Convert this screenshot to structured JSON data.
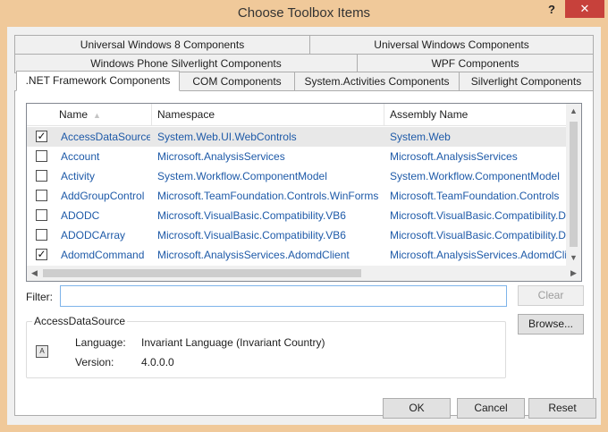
{
  "window": {
    "title": "Choose Toolbox Items",
    "help_label": "?",
    "close_label": "✕"
  },
  "tabs": {
    "row1": [
      "Universal Windows 8 Components",
      "Universal Windows Components"
    ],
    "row2": [
      "Windows Phone Silverlight Components",
      "WPF Components"
    ],
    "row3": [
      ".NET Framework Components",
      "COM Components",
      "System.Activities Components",
      "Silverlight Components"
    ],
    "active": ".NET Framework Components"
  },
  "list": {
    "columns": [
      "Name",
      "Namespace",
      "Assembly Name"
    ],
    "sort_indicator": "▲",
    "rows": [
      {
        "checked": true,
        "name": "AccessDataSource",
        "namespace": "System.Web.UI.WebControls",
        "assembly": "System.Web",
        "selected": true
      },
      {
        "checked": false,
        "name": "Account",
        "namespace": "Microsoft.AnalysisServices",
        "assembly": "Microsoft.AnalysisServices"
      },
      {
        "checked": false,
        "name": "Activity",
        "namespace": "System.Workflow.ComponentModel",
        "assembly": "System.Workflow.ComponentModel"
      },
      {
        "checked": false,
        "name": "AddGroupControl",
        "namespace": "Microsoft.TeamFoundation.Controls.WinForms",
        "assembly": "Microsoft.TeamFoundation.Controls"
      },
      {
        "checked": false,
        "name": "ADODC",
        "namespace": "Microsoft.VisualBasic.Compatibility.VB6",
        "assembly": "Microsoft.VisualBasic.Compatibility.Da"
      },
      {
        "checked": false,
        "name": "ADODCArray",
        "namespace": "Microsoft.VisualBasic.Compatibility.VB6",
        "assembly": "Microsoft.VisualBasic.Compatibility.Da"
      },
      {
        "checked": true,
        "name": "AdomdCommand",
        "namespace": "Microsoft.AnalysisServices.AdomdClient",
        "assembly": "Microsoft.AnalysisServices.AdomdClie"
      }
    ],
    "check_mark": "✓"
  },
  "filter": {
    "label": "Filter:",
    "value": "",
    "clear_label": "Clear"
  },
  "browse_label": "Browse...",
  "details": {
    "title": "AccessDataSource",
    "language_label": "Language:",
    "language_value": "Invariant Language (Invariant Country)",
    "version_label": "Version:",
    "version_value": "4.0.0.0"
  },
  "buttons": {
    "ok": "OK",
    "cancel": "Cancel",
    "reset": "Reset"
  }
}
